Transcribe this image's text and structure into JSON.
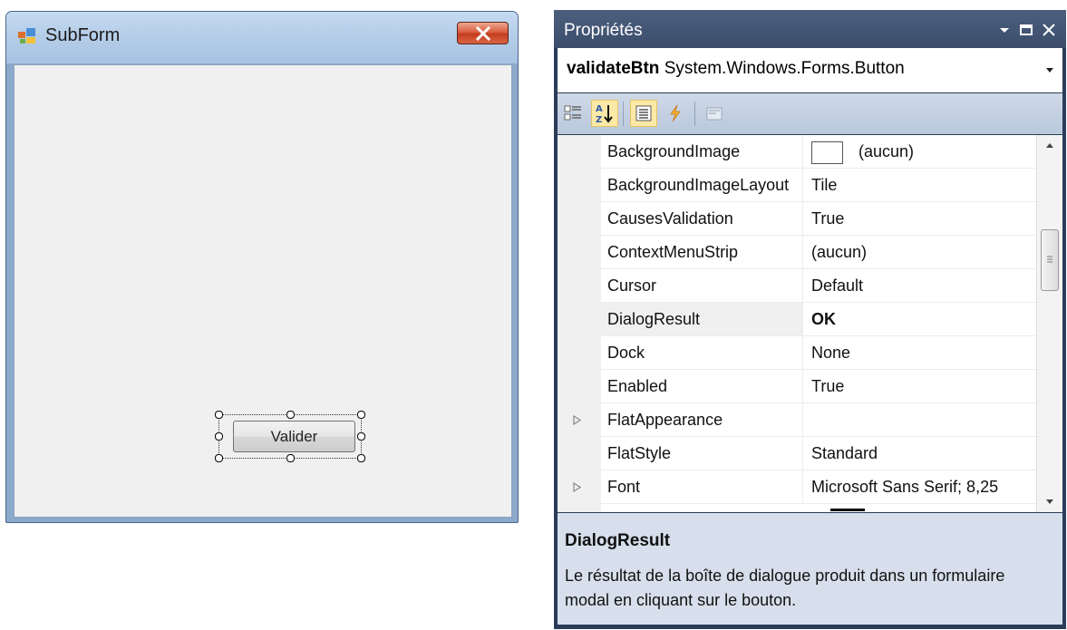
{
  "subform": {
    "title": "SubForm",
    "button_label": "Valider"
  },
  "properties_panel": {
    "title": "Propriétés",
    "object_name": "validateBtn",
    "object_type": "System.Windows.Forms.Button",
    "rows": [
      {
        "name": "BackgroundImage",
        "value": "(aucun)"
      },
      {
        "name": "BackgroundImageLayout",
        "value": "Tile"
      },
      {
        "name": "CausesValidation",
        "value": "True"
      },
      {
        "name": "ContextMenuStrip",
        "value": "(aucun)"
      },
      {
        "name": "Cursor",
        "value": "Default"
      },
      {
        "name": "DialogResult",
        "value": "OK"
      },
      {
        "name": "Dock",
        "value": "None"
      },
      {
        "name": "Enabled",
        "value": "True"
      },
      {
        "name": "FlatAppearance",
        "value": ""
      },
      {
        "name": "FlatStyle",
        "value": "Standard"
      },
      {
        "name": "Font",
        "value": "Microsoft Sans Serif; 8,25"
      }
    ],
    "selected_property": "DialogResult",
    "description": {
      "title": "DialogResult",
      "text": "Le résultat de la boîte de dialogue produit dans un formulaire modal en cliquant sur le bouton."
    }
  },
  "colors": {
    "titlebar_blue": "#b5cde8",
    "close_red": "#d9593a",
    "panel_dark": "#2b3c59",
    "toolbar_active": "#fde9a7",
    "description_bg": "#d6dfeb"
  }
}
